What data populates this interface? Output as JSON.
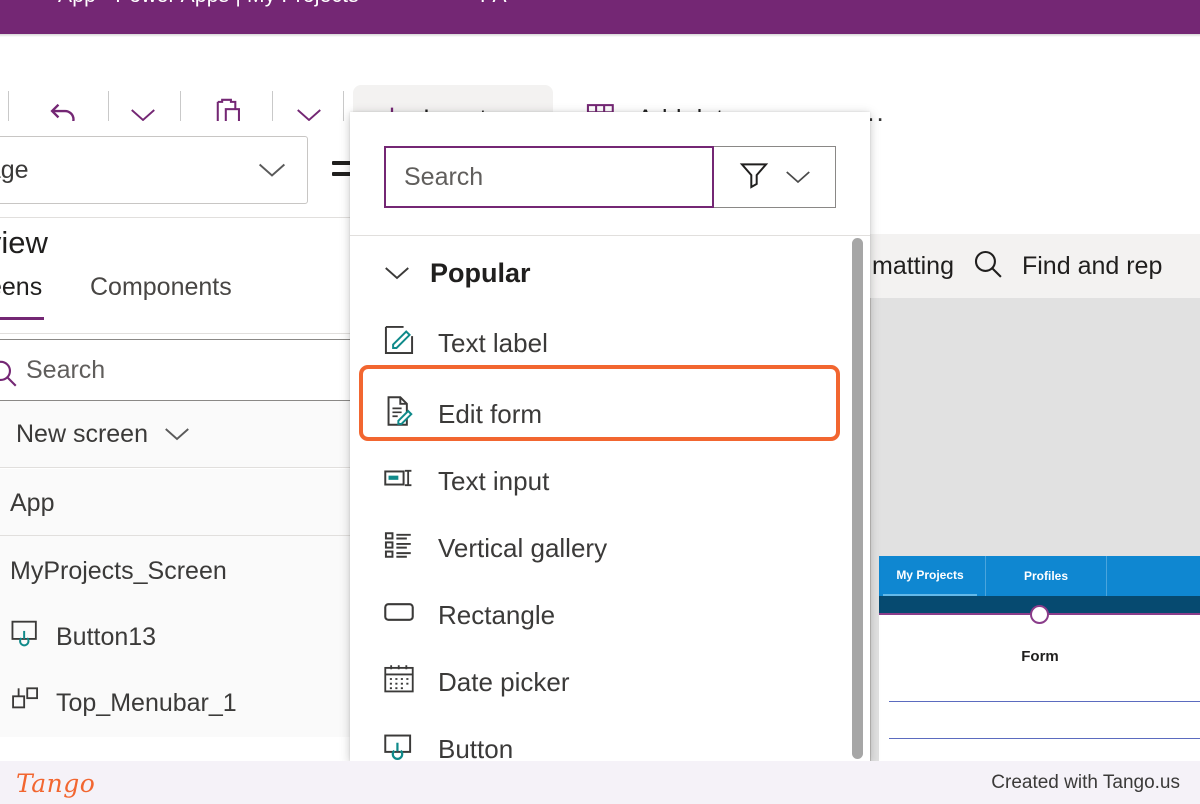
{
  "appbar": {
    "title": "App · Power Apps | My Projects",
    "right_text": "PA"
  },
  "ribbon": {
    "undo_label": "Undo",
    "undo_dropdown_label": "Undo options",
    "paste_label": "Paste",
    "paste_dropdown_label": "Paste options",
    "insert_label": "Insert",
    "insert_dropdown_label": "Insert options",
    "add_data_label": "Add data",
    "add_data_dropdown_label": "Add data options",
    "more_label": "..."
  },
  "left_panel": {
    "language_value": "guage",
    "title": "e view",
    "tabs": [
      {
        "label": "eens",
        "active": true
      },
      {
        "label": "Components",
        "active": false
      }
    ],
    "search_placeholder": "Search",
    "new_screen_label": "New screen",
    "tree": [
      {
        "label": "App",
        "icon": "none"
      },
      {
        "label": "MyProjects_Screen",
        "icon": "none"
      },
      {
        "label": "Button13",
        "icon": "button-icon"
      },
      {
        "label": "Top_Menubar_1",
        "icon": "component-icon"
      }
    ]
  },
  "right_panel": {
    "formatting_text": "matting",
    "find_replace_label": "Find and rep",
    "app_preview": {
      "tabs": [
        {
          "label": "My Projects",
          "selected": true
        },
        {
          "label": "Profiles",
          "selected": false
        }
      ],
      "form_title": "Form"
    }
  },
  "flyout": {
    "search_placeholder": "Search",
    "filter_label": "Filter",
    "filter_dropdown_label": "Filter options",
    "group_label": "Popular",
    "items": [
      {
        "label": "Text label",
        "icon": "text-label-icon",
        "highlighted": false
      },
      {
        "label": "Edit form",
        "icon": "edit-form-icon",
        "highlighted": true
      },
      {
        "label": "Text input",
        "icon": "text-input-icon",
        "highlighted": false
      },
      {
        "label": "Vertical gallery",
        "icon": "vertical-gallery-icon",
        "highlighted": false
      },
      {
        "label": "Rectangle",
        "icon": "rectangle-icon",
        "highlighted": false
      },
      {
        "label": "Date picker",
        "icon": "date-picker-icon",
        "highlighted": false
      },
      {
        "label": "Button",
        "icon": "button-icon",
        "highlighted": false
      }
    ]
  },
  "footer": {
    "logo_text": "Tango",
    "credit": "Created with Tango.us"
  },
  "colors": {
    "brand_purple": "#742774",
    "highlight_orange": "#f26630",
    "preview_blue": "#0f87d1",
    "preview_dark_blue": "#064a70",
    "accent_teal": "#0f8a8a"
  }
}
